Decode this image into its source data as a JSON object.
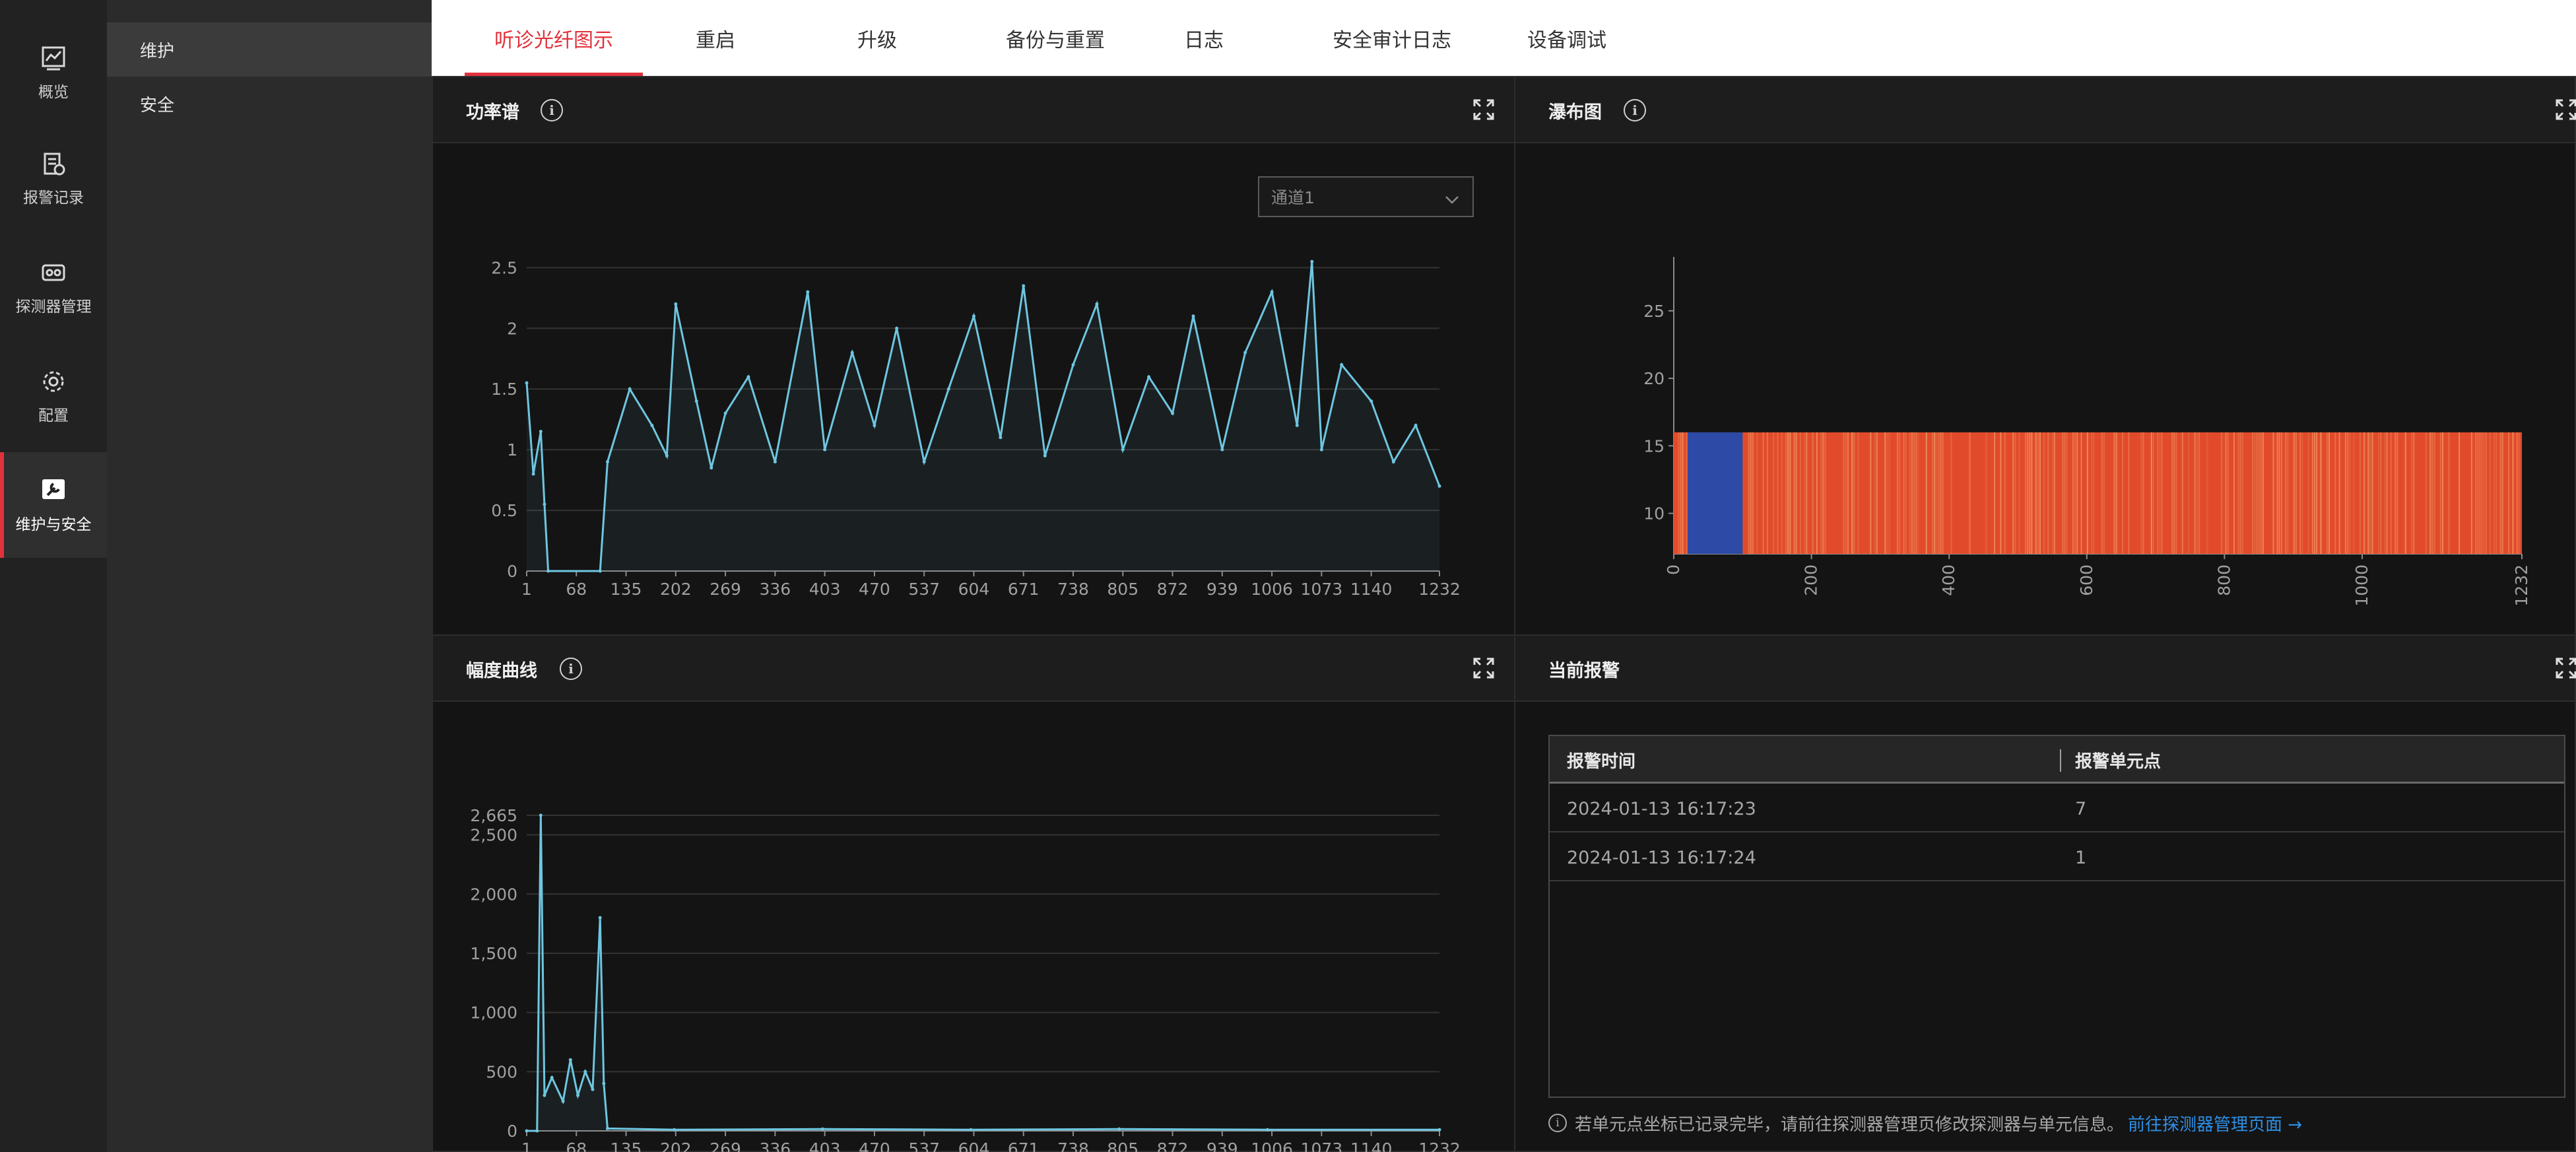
{
  "rail": {
    "items": [
      {
        "label": "概览",
        "icon": "overview-icon"
      },
      {
        "label": "报警记录",
        "icon": "alarm-record-icon"
      },
      {
        "label": "探测器管理",
        "icon": "detector-icon"
      },
      {
        "label": "配置",
        "icon": "gear-icon"
      },
      {
        "label": "维护与安全",
        "icon": "wrench-icon"
      }
    ],
    "active_index": 4
  },
  "submenu": {
    "items": [
      {
        "label": "维护"
      },
      {
        "label": "安全"
      }
    ],
    "active_index": 0
  },
  "tabs": {
    "items": [
      {
        "label": "听诊光纤图示"
      },
      {
        "label": "重启"
      },
      {
        "label": "升级"
      },
      {
        "label": "备份与重置"
      },
      {
        "label": "日志"
      },
      {
        "label": "安全审计日志"
      },
      {
        "label": "设备调试"
      }
    ],
    "active_index": 0
  },
  "colors": {
    "accent": "#e2313b",
    "line": "#6ec6e0",
    "link": "#2e8fe6",
    "waterfall_blue": "#2c4aa6",
    "waterfall_red": "#e14b2c",
    "waterfall_light": "#f4a067"
  },
  "power_panel": {
    "title": "功率谱",
    "select_value": "通道1"
  },
  "waterfall_panel": {
    "title": "瀑布图"
  },
  "amplitude_panel": {
    "title": "幅度曲线"
  },
  "alarm_panel": {
    "title": "当前报警",
    "columns": [
      "报警时间",
      "报警单元点"
    ],
    "rows": [
      [
        "2024-01-13 16:17:23",
        "7"
      ],
      [
        "2024-01-13 16:17:24",
        "1"
      ]
    ],
    "note": "若单元点坐标已记录完毕，请前往探测器管理页修改探测器与单元信息。",
    "note_link": "前往探测器管理页面",
    "note_link_arrow": "→"
  },
  "chart_data": [
    {
      "type": "line",
      "title": "",
      "xlabel": "",
      "ylabel": "",
      "x_ticks": [
        "1",
        "68",
        "135",
        "202",
        "269",
        "336",
        "403",
        "470",
        "537",
        "604",
        "671",
        "738",
        "805",
        "872",
        "939",
        "1006",
        "1073",
        "1140",
        "1232"
      ],
      "y_ticks": [
        "0",
        "0.5",
        "1",
        "1.5",
        "2",
        "2.5"
      ],
      "xlim": [
        1,
        1232
      ],
      "ylim": [
        0,
        2.6
      ],
      "grid": true,
      "series": [
        {
          "x": [
            1,
            10,
            20,
            25,
            30,
            100,
            110,
            140,
            170,
            190,
            202,
            230,
            250,
            269,
            300,
            336,
            380,
            403,
            440,
            470,
            500,
            537,
            570,
            604,
            640,
            671,
            700,
            738,
            770,
            805,
            840,
            872,
            900,
            939,
            970,
            1006,
            1040,
            1060,
            1073,
            1100,
            1140,
            1170,
            1200,
            1232
          ],
          "y": [
            1.55,
            0.8,
            1.15,
            0.55,
            0,
            0,
            0.9,
            1.5,
            1.2,
            0.95,
            2.2,
            1.4,
            0.85,
            1.3,
            1.6,
            0.9,
            2.3,
            1.0,
            1.8,
            1.2,
            2.0,
            0.9,
            1.5,
            2.1,
            1.1,
            2.35,
            0.95,
            1.7,
            2.2,
            1.0,
            1.6,
            1.3,
            2.1,
            1.0,
            1.8,
            2.3,
            1.2,
            2.55,
            1.0,
            1.7,
            1.4,
            0.9,
            1.2,
            0.7
          ]
        }
      ]
    },
    {
      "type": "heatmap",
      "title": "",
      "x_ticks": [
        "0",
        "200",
        "400",
        "600",
        "800",
        "1000",
        "1232"
      ],
      "y_ticks": [
        "10",
        "15",
        "20",
        "25"
      ],
      "xlim": [
        0,
        1232
      ],
      "ylim": [
        7,
        29
      ],
      "data_y_range": [
        7,
        16
      ],
      "blue_band_x": [
        20,
        100
      ]
    },
    {
      "type": "line",
      "title": "",
      "x_ticks": [
        "1",
        "68",
        "135",
        "202",
        "269",
        "336",
        "403",
        "470",
        "537",
        "604",
        "671",
        "738",
        "805",
        "872",
        "939",
        "1006",
        "1073",
        "1140",
        "1232"
      ],
      "y_ticks": [
        "0",
        "500",
        "1,000",
        "1,500",
        "2,000",
        "2,500",
        "2,665"
      ],
      "xlim": [
        1,
        1232
      ],
      "ylim": [
        0,
        2665
      ],
      "grid": true,
      "series": [
        {
          "x": [
            1,
            15,
            20,
            25,
            35,
            50,
            60,
            70,
            80,
            90,
            100,
            105,
            110,
            200,
            400,
            600,
            800,
            1000,
            1232
          ],
          "y": [
            0,
            0,
            2665,
            300,
            450,
            250,
            600,
            300,
            500,
            350,
            1800,
            400,
            20,
            10,
            15,
            10,
            15,
            10,
            10
          ]
        }
      ]
    }
  ]
}
